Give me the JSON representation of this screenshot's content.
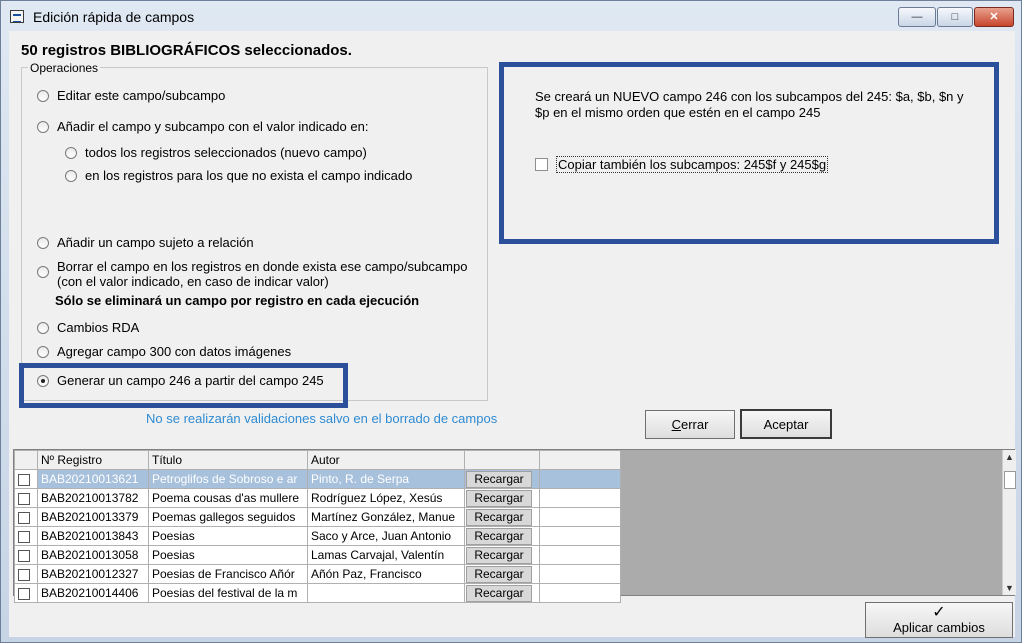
{
  "window": {
    "title": "Edición rápida de campos",
    "controls": {
      "minimize": "—",
      "maximize": "□",
      "close": "✕"
    }
  },
  "heading": "50 registros BIBLIOGRÁFICOS seleccionados.",
  "operations": {
    "label": "Operaciones",
    "options": [
      {
        "label": "Editar este campo/subcampo",
        "selected": false
      },
      {
        "label": "Añadir el campo y subcampo con el valor indicado en:",
        "selected": false
      },
      {
        "label": "todos los registros seleccionados (nuevo campo)",
        "selected": false
      },
      {
        "label": "en los registros para los que no exista el campo indicado",
        "selected": false
      },
      {
        "label": "Añadir un campo sujeto a relación",
        "selected": false
      },
      {
        "label_lines": [
          "Borrar el campo en los registros en donde exista ese campo/subcampo",
          "(con el valor indicado, en caso de indicar valor)"
        ],
        "selected": false
      },
      {
        "label": "Cambios RDA",
        "selected": false
      },
      {
        "label": "Agregar campo 300 con datos imágenes",
        "selected": false
      },
      {
        "label": "Generar un campo 246 a partir del campo 245",
        "selected": true
      }
    ],
    "delete_note": "Sólo se eliminará un campo por registro en cada ejecución"
  },
  "info_panel": {
    "text": "Se creará un NUEVO campo 246 con los subcampos del 245: $a, $b, $n y $p en el mismo orden que estén en el campo 245",
    "checkbox_label": "Copiar también los subcampos: 245$f y 245$g",
    "checkbox_checked": false
  },
  "warning": "No se realizarán validaciones salvo en el borrado de campos",
  "buttons": {
    "cerrar_first": "C",
    "cerrar_rest": "errar",
    "aceptar": "Aceptar",
    "aplicar": "Aplicar cambios",
    "aplicar_icon": "✓"
  },
  "grid": {
    "columns": [
      "",
      "Nº Registro",
      "Título",
      "Autor",
      "",
      ""
    ],
    "reload_label": "Recargar",
    "rows": [
      {
        "registro": "BAB20210013621",
        "titulo": "Petroglifos de Sobroso e ar",
        "autor": "Pinto, R. de Serpa",
        "selected": true
      },
      {
        "registro": "BAB20210013782",
        "titulo": "Poema cousas d'as mullere",
        "autor": "Rodríguez López, Xesús",
        "selected": false
      },
      {
        "registro": "BAB20210013379",
        "titulo": "Poemas gallegos seguidos",
        "autor": "Martínez González, Manue",
        "selected": false
      },
      {
        "registro": "BAB20210013843",
        "titulo": "Poesias",
        "autor": "Saco y Arce, Juan Antonio",
        "selected": false
      },
      {
        "registro": "BAB20210013058",
        "titulo": "Poesias",
        "autor": "Lamas Carvajal, Valentín",
        "selected": false
      },
      {
        "registro": "BAB20210012327",
        "titulo": "Poesias de Francisco Añór",
        "autor": "Añón Paz, Francisco",
        "selected": false
      },
      {
        "registro": "BAB20210014406",
        "titulo": "Poesias del festival de la m",
        "autor": "",
        "selected": false
      }
    ]
  },
  "colors": {
    "highlight_border": "#2b4f9a",
    "warning_text": "#2e8bd3",
    "selected_row": "#a7c0dc"
  }
}
